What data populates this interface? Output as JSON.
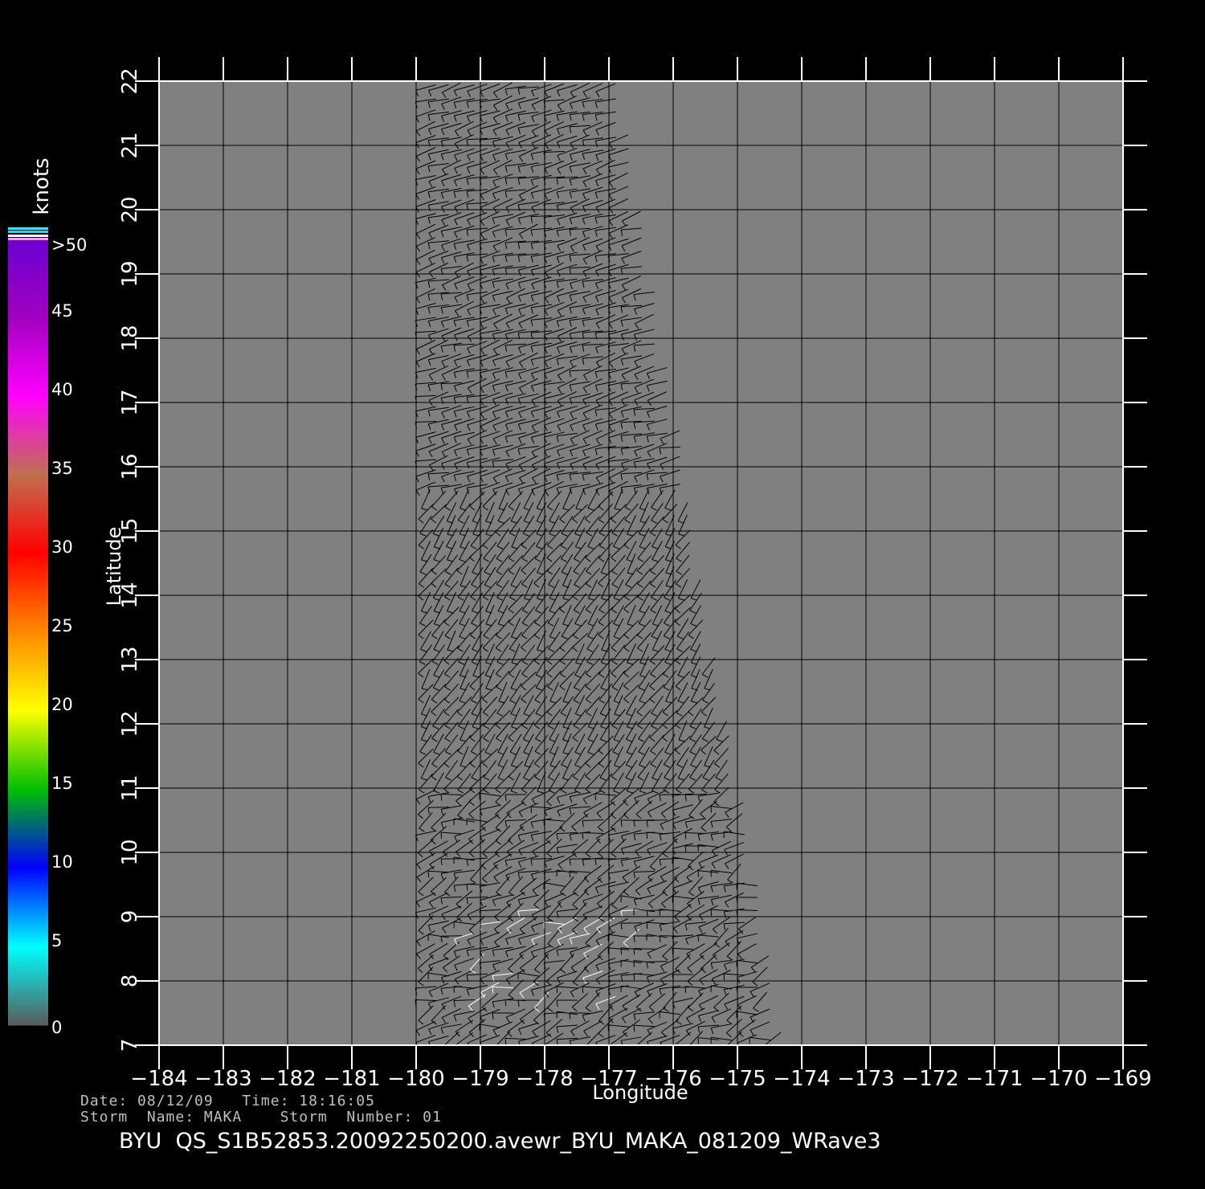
{
  "chart_data": {
    "type": "scatter",
    "title": "BYU  QS_S1B52853.20092250200.avewr_BYU_MAKA_081209_WRave3",
    "xlabel": "Longitude",
    "ylabel": "Latitude",
    "xlim": [
      -184,
      -169
    ],
    "ylim": [
      7,
      22
    ],
    "x_ticks": [
      "−184",
      "−183",
      "−182",
      "−181",
      "−180",
      "−179",
      "−178",
      "−177",
      "−176",
      "−175",
      "−174",
      "−173",
      "−172",
      "−171",
      "−170",
      "−169"
    ],
    "y_ticks": [
      "7",
      "8",
      "9",
      "10",
      "11",
      "12",
      "13",
      "14",
      "15",
      "16",
      "17",
      "18",
      "19",
      "20",
      "21",
      "22"
    ],
    "grid": true,
    "plot_background": "#808080",
    "swath": {
      "description_units": "degrees",
      "corners": [
        [
          -180.0,
          21.95
        ],
        [
          -177.0,
          22.0
        ],
        [
          -174.4,
          7.0
        ],
        [
          -180.0,
          7.0
        ]
      ]
    },
    "barbs": {
      "color": "#000000",
      "highlight_color": "#ffffff",
      "regions": [
        {
          "lat_range": [
            15.5,
            22
          ],
          "direction_deg": 255,
          "speed_kt": 15
        },
        {
          "lat_range": [
            11,
            15.5
          ],
          "direction_deg": 215,
          "speed_kt": 15
        },
        {
          "lat_range": [
            7,
            11
          ],
          "direction_deg": 250,
          "speed_kt": 10
        }
      ]
    },
    "colorbar": {
      "label": "knots",
      "ticks": [
        "0",
        "5",
        "10",
        "15",
        "20",
        "25",
        "30",
        "35",
        "40",
        "45",
        ">50"
      ],
      "colors": [
        "#5a5a5a",
        "#00ffff",
        "#0000ff",
        "#00c000",
        "#ffff00",
        "#ff8800",
        "#ff0000",
        "#c07050",
        "#ff00ff",
        "#a000c0",
        "#6a00d0"
      ]
    }
  },
  "info": {
    "line1": "Date: 08/12/09   Time: 18:16:05",
    "line2": "Storm  Name: MAKA    Storm  Number: 01"
  }
}
